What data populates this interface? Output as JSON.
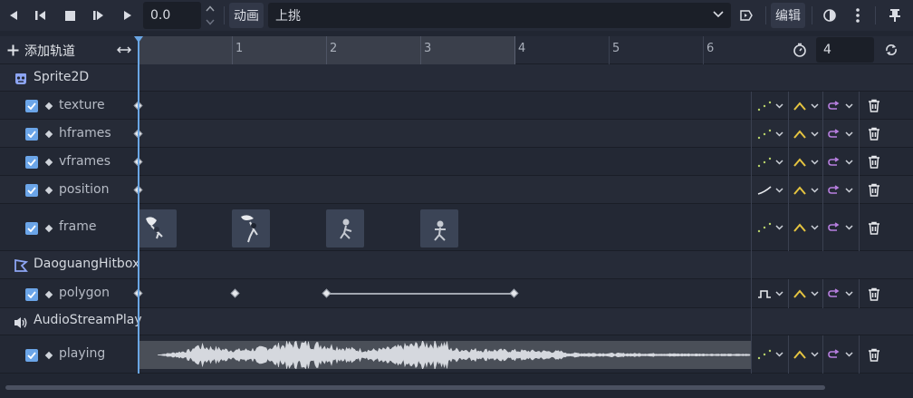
{
  "toolbar": {
    "time_value": "0.0",
    "animation_label": "动画",
    "animation_name": "上挑",
    "edit_label": "编辑"
  },
  "timeline": {
    "add_track_label": "添加轨道",
    "ticks": [
      "1",
      "2",
      "3",
      "4",
      "5",
      "6"
    ],
    "length_value": "4"
  },
  "groups": [
    {
      "name": "Sprite2D",
      "icon": "sprite2d-icon",
      "tracks": [
        {
          "label": "texture",
          "interp": "dots"
        },
        {
          "label": "hframes",
          "interp": "dots"
        },
        {
          "label": "vframes",
          "interp": "dots"
        },
        {
          "label": "position",
          "interp": "curve"
        },
        {
          "label": "frame",
          "interp": "dots"
        }
      ]
    },
    {
      "name": "DaoguangHitbox",
      "icon": "collision-polygon-icon",
      "tracks": [
        {
          "label": "polygon",
          "interp": "step"
        }
      ]
    },
    {
      "name": "AudioStreamPlay",
      "icon": "audio-icon",
      "tracks": [
        {
          "label": "playing",
          "interp": "dots"
        }
      ]
    }
  ],
  "colors": {
    "accent": "#6ba5e8",
    "interp_yellow": "#e5c440",
    "loop_purple": "#b87fe0",
    "dots_green": "#b8d36a"
  }
}
